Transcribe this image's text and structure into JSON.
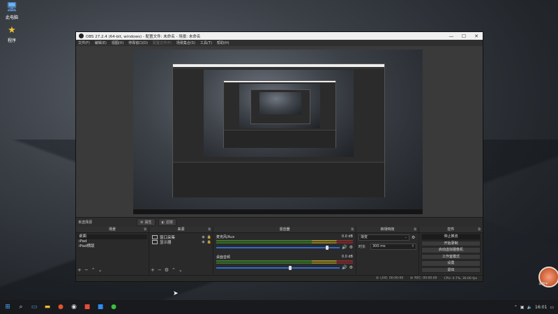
{
  "desktop": {
    "icons": [
      {
        "label": "此电脑",
        "icon": "computer-icon",
        "glyph": "🖥"
      },
      {
        "label": "程序",
        "icon": "star-icon",
        "glyph": "★"
      }
    ]
  },
  "window": {
    "title": "OBS 27.2.4 (64-bit, windows) - 配置文件: 未命名 - 场景: 未命名",
    "controls": {
      "minimize": "—",
      "maximize": "☐",
      "close": "✕"
    },
    "menu": [
      "文件(F)",
      "编辑(E)",
      "视图(V)",
      "停靠窗口(D)",
      "配置文件(P)",
      "场景集合(S)",
      "工具(T)",
      "帮助(H)"
    ]
  },
  "scene_strip": {
    "current": "未选择源",
    "properties": "属性",
    "filters": "滤镜"
  },
  "docks": {
    "scenes": {
      "title": "场景",
      "items": [
        "桌面",
        "iPad",
        "iPad横版"
      ],
      "toolbar": [
        "+",
        "−",
        "⌃",
        "⌄"
      ]
    },
    "sources": {
      "title": "来源",
      "items": [
        "窗口采集",
        "显示器"
      ],
      "toolbar": [
        "+",
        "−",
        "⚙",
        "⌃",
        "⌄"
      ]
    },
    "mixer": {
      "title": "混音器",
      "channels": [
        {
          "name": "麦克风/Aux",
          "db": "0.0 dB",
          "level": 0.9
        },
        {
          "name": "桌面音频",
          "db": "0.0 dB",
          "level": 0.6
        }
      ]
    },
    "transitions": {
      "title": "转场特效",
      "type": "渐变",
      "duration_label": "时长",
      "duration": "300 ms"
    },
    "controls": {
      "title": "控件",
      "buttons": [
        "停止推流",
        "开始录制",
        "启动虚拟摄像机",
        "工作室模式",
        "设置",
        "退出"
      ],
      "active_index": 0
    }
  },
  "status": {
    "live": "LIVE: 00:00:00",
    "rec": "REC: 00:00:00",
    "cpu": "CPU: 0.7%, 30.00 fps"
  },
  "taskbar": {
    "apps": [
      "windows-start-icon",
      "search-icon",
      "task-view-icon",
      "folder-icon",
      "browser-icon",
      "obs-icon",
      "app-icon",
      "app-icon",
      "wechat-icon"
    ],
    "recorder_label": "录制中",
    "clock": "16:01"
  },
  "colors": {
    "accent": "#2e6bd0",
    "panel": "#2a2a2a",
    "meter_green": "#3b7a2a",
    "meter_yellow": "#9b8a26",
    "meter_red": "#8b2a2a"
  }
}
